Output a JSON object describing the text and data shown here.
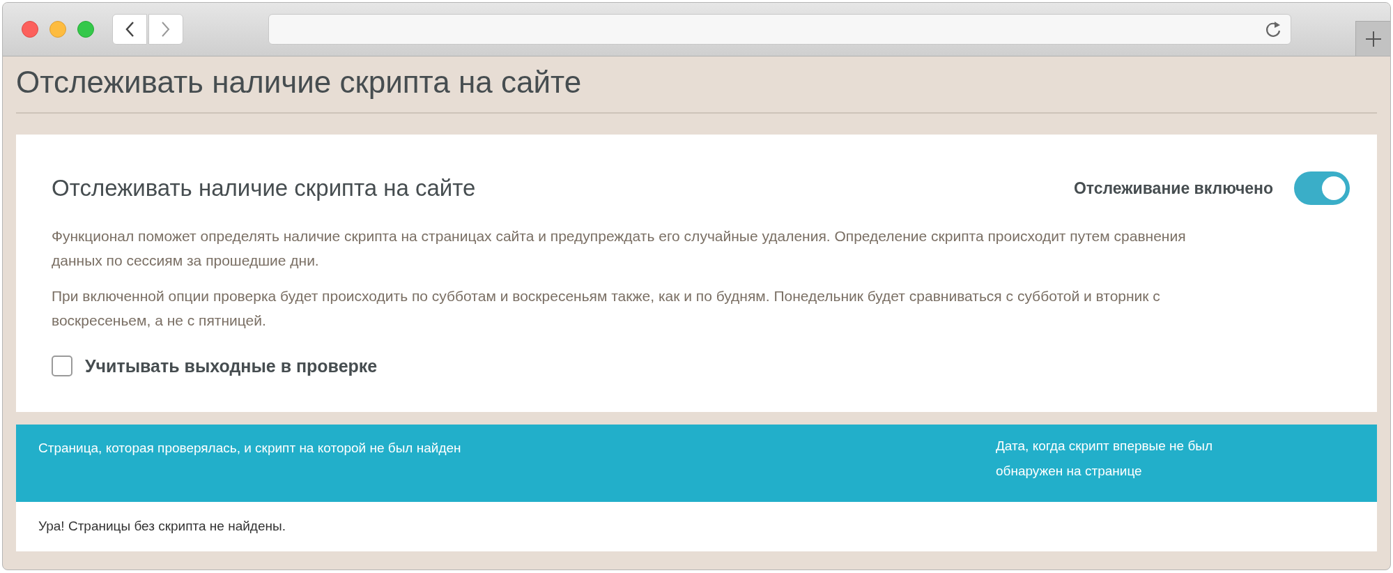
{
  "page_title": "Отслеживать наличие скрипта на сайте",
  "card": {
    "title": "Отслеживать наличие скрипта на сайте",
    "toggle": {
      "label": "Отслеживание включено",
      "on": true
    },
    "paragraphs": [
      "Функционал поможет определять наличие скрипта на страницах сайта и предупреждать его случайные удаления. Определение скрипта происходит путем сравнения данных по сессиям за прошедшие дни.",
      "При включенной опции проверка будет происходить по субботам и воскресеньям также, как и по будням. Понедельник будет сравниваться с субботой и вторник с воскресеньем, а не с пятницей."
    ],
    "checkbox": {
      "label": "Учитывать выходные в проверке",
      "checked": false
    }
  },
  "table": {
    "columns": [
      "Страница, которая проверялась, и скрипт на которой не был найден",
      "Дата, когда скрипт впервые не был обнаружен на странице"
    ],
    "empty_message": "Ура! Страницы без скрипта не найдены."
  }
}
